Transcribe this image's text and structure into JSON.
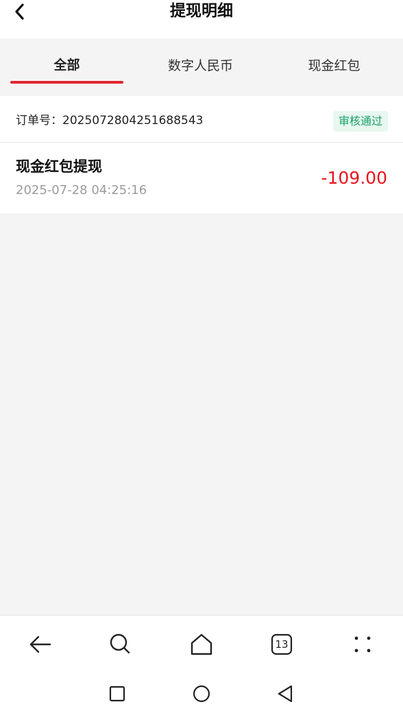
{
  "header": {
    "title": "提现明细"
  },
  "tabs": [
    {
      "label": "全部",
      "active": true
    },
    {
      "label": "数字人民币",
      "active": false
    },
    {
      "label": "现金红包",
      "active": false
    }
  ],
  "record": {
    "order_label": "订单号：2025072804251688543",
    "status": "审核通过",
    "title": "现金红包提现",
    "time": "2025-07-28 04:25:16",
    "amount": "-109.00"
  },
  "toolbar": {
    "tab_count": "13"
  },
  "colors": {
    "accent": "#e0262d",
    "amount": "#e8141c",
    "status_text": "#17a36b",
    "status_bg": "#e8f7ef"
  }
}
